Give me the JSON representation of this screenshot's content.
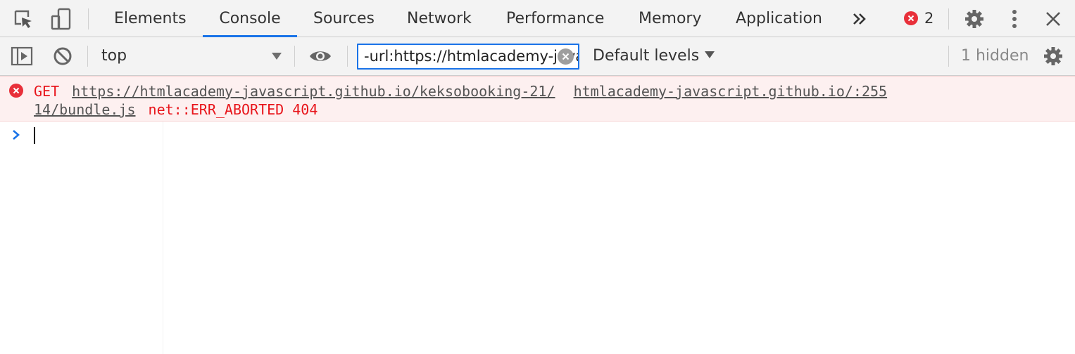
{
  "tabbar": {
    "tabs": [
      {
        "label": "Elements",
        "active": false
      },
      {
        "label": "Console",
        "active": true
      },
      {
        "label": "Sources",
        "active": false
      },
      {
        "label": "Network",
        "active": false
      },
      {
        "label": "Performance",
        "active": false
      },
      {
        "label": "Memory",
        "active": false
      },
      {
        "label": "Application",
        "active": false
      }
    ],
    "overflow_icon": "double-chevron-right-icon",
    "error_count": "2",
    "icons": [
      "inspect-element-icon",
      "device-toolbar-icon",
      "settings-gear-icon",
      "more-vertical-icon",
      "close-icon"
    ]
  },
  "toolbar": {
    "context": "top",
    "filter_value": "-url:https://htmlacademy-javascript.github.io",
    "levels_label": "Default levels",
    "hidden_label": "1 hidden",
    "icons": [
      "show-sidebar-icon",
      "clear-console-icon",
      "eye-icon",
      "console-settings-gear-icon"
    ]
  },
  "console": {
    "error": {
      "method": "GET",
      "url": "https://htmlacademy-javascript.github.io/keksobooking-21/",
      "source": "htmlacademy-javascript.github.io/:255",
      "url_cont": "14/bundle.js",
      "status": "net::ERR_ABORTED 404"
    }
  },
  "colors": {
    "accent": "#1a73e8",
    "error_red": "#e8151b",
    "error_bg": "#fdf0f0",
    "toolbar_bg": "#f3f3f3"
  }
}
